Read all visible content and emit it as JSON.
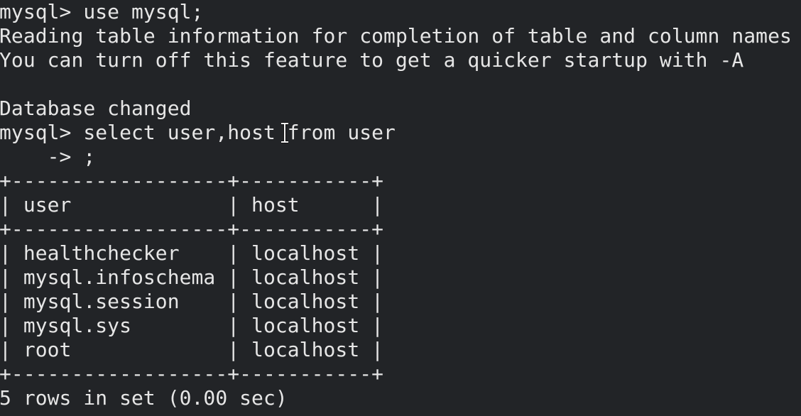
{
  "terminal": {
    "lines": [
      {
        "kind": "command",
        "prompt": "mysql> ",
        "text": "use mysql;"
      },
      {
        "kind": "output",
        "text": "Reading table information for completion of table and column names"
      },
      {
        "kind": "output",
        "text": "You can turn off this feature to get a quicker startup with -A"
      },
      {
        "kind": "blank",
        "text": ""
      },
      {
        "kind": "output",
        "text": "Database changed"
      },
      {
        "kind": "command",
        "prompt": "mysql> ",
        "text": "select user,host from user"
      },
      {
        "kind": "continuation",
        "prompt": "    -> ",
        "text": ";"
      }
    ],
    "result_table": {
      "border": "+------------------+-----------+",
      "columns": [
        "user",
        "host"
      ],
      "header_line": "| user             | host      |",
      "rows": [
        {
          "user": "healthchecker",
          "host": "localhost",
          "line": "| healthchecker    | localhost |"
        },
        {
          "user": "mysql.infoschema",
          "host": "localhost",
          "line": "| mysql.infoschema | localhost |"
        },
        {
          "user": "mysql.session",
          "host": "localhost",
          "line": "| mysql.session    | localhost |"
        },
        {
          "user": "mysql.sys",
          "host": "localhost",
          "line": "| mysql.sys        | localhost |"
        },
        {
          "user": "root",
          "host": "localhost",
          "line": "| root             | localhost |"
        }
      ]
    },
    "summary": "5 rows in set (0.00 sec)",
    "colors": {
      "background": "#222427",
      "foreground": "#e6e6e6"
    }
  }
}
